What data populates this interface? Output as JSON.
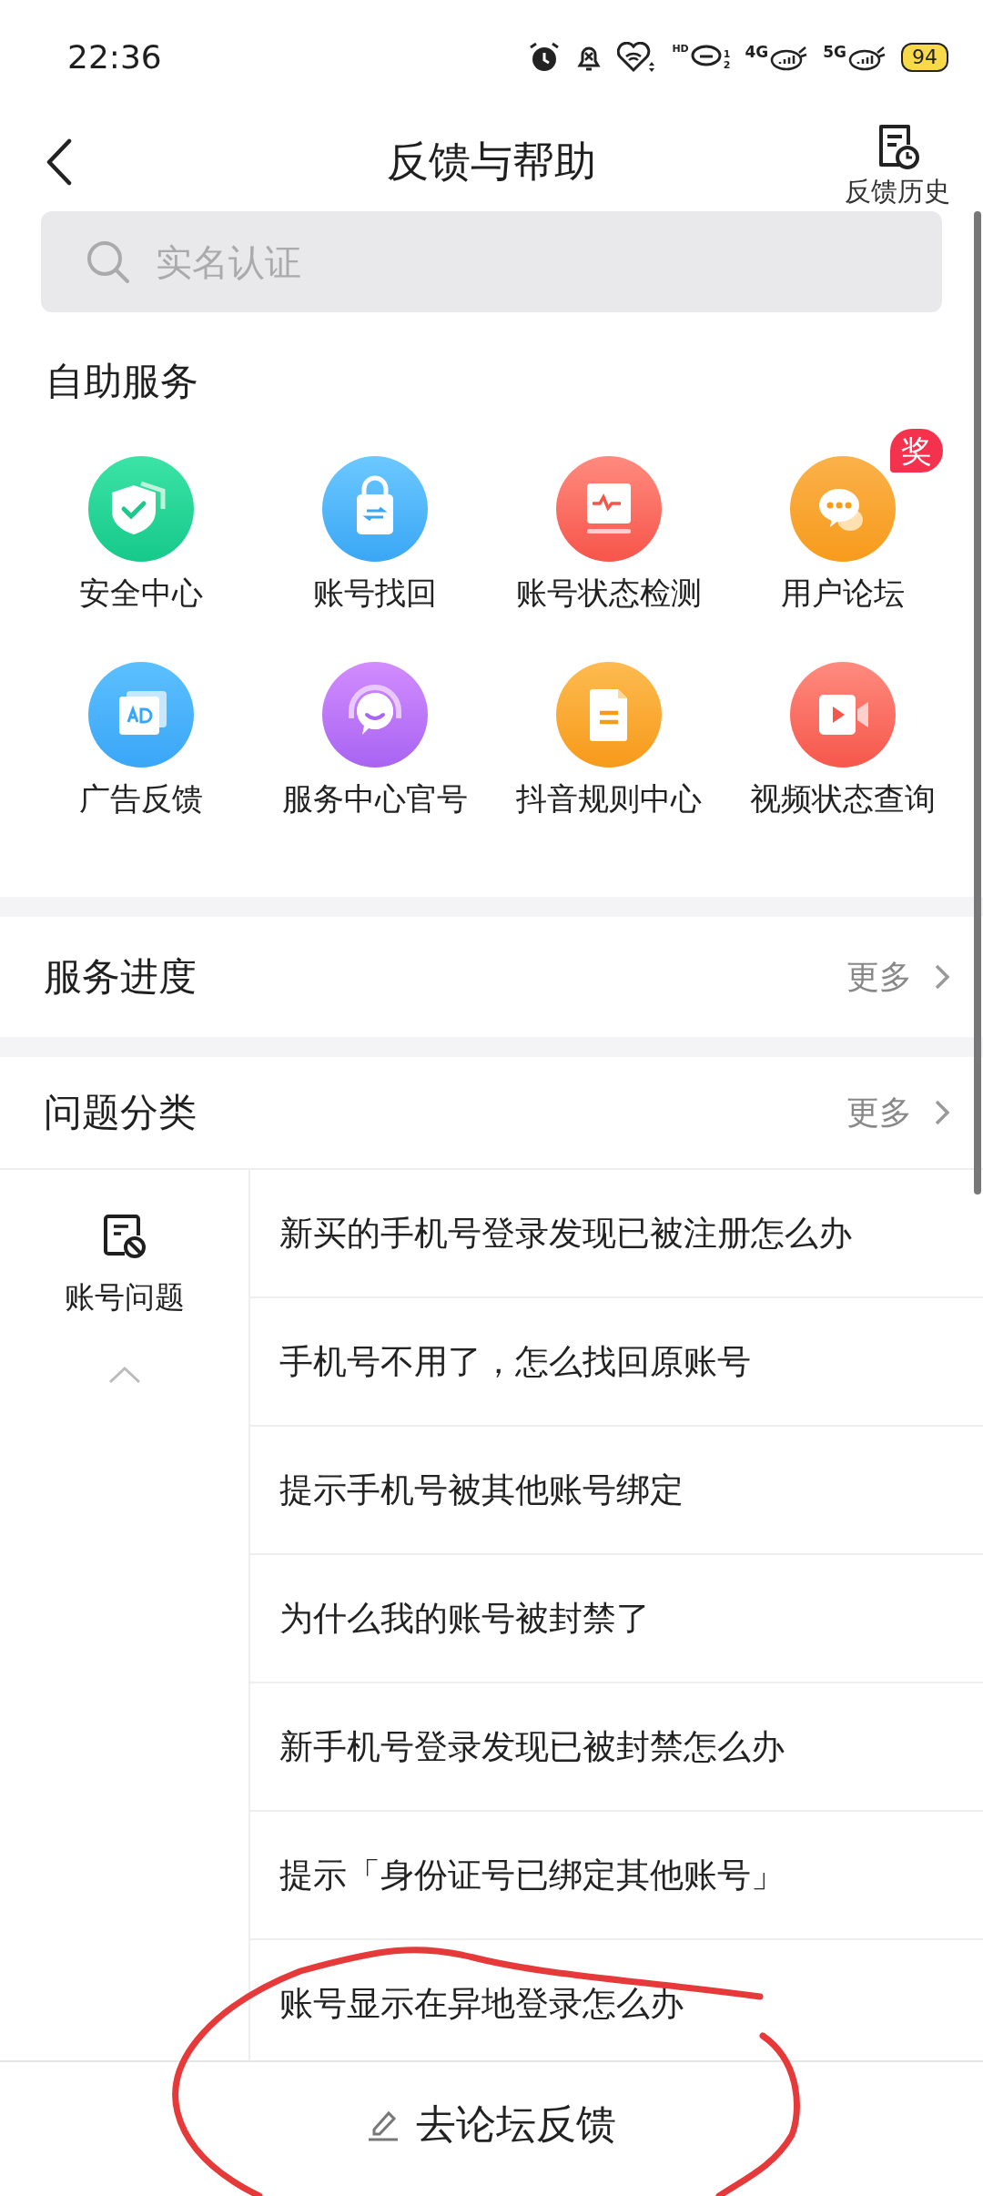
{
  "status_bar": {
    "time": "22:36",
    "hd_label": "HD",
    "sim_slots": [
      "1",
      "2"
    ],
    "networks": [
      "4G",
      "5G"
    ],
    "battery": "94"
  },
  "header": {
    "title": "反馈与帮助",
    "history_label": "反馈历史"
  },
  "search": {
    "placeholder": "实名认证"
  },
  "self_service": {
    "title": "自助服务",
    "items": [
      {
        "kind": "shield",
        "label": "安全中心"
      },
      {
        "kind": "bag",
        "label": "账号找回"
      },
      {
        "kind": "monitor",
        "label": "账号状态检测"
      },
      {
        "kind": "chat",
        "label": "用户论坛",
        "badge": "奖"
      },
      {
        "kind": "ad",
        "label": "广告反馈"
      },
      {
        "kind": "headset",
        "label": "服务中心官号"
      },
      {
        "kind": "document",
        "label": "抖音规则中心"
      },
      {
        "kind": "video",
        "label": "视频状态查询"
      }
    ]
  },
  "service_progress": {
    "title": "服务进度",
    "more": "更多"
  },
  "categories": {
    "title": "问题分类",
    "more": "更多",
    "sidebar": [
      {
        "label": "账号问题",
        "selected": true
      }
    ],
    "questions": [
      "新买的手机号登录发现已被注册怎么办",
      "手机号不用了，怎么找回原账号",
      "提示手机号被其他账号绑定",
      "为什么我的账号被封禁了",
      "新手机号登录发现已被封禁怎么办",
      "提示「身份证号已绑定其他账号」",
      "账号显示在异地登录怎么办"
    ]
  },
  "footer": {
    "button": "去论坛反馈"
  }
}
